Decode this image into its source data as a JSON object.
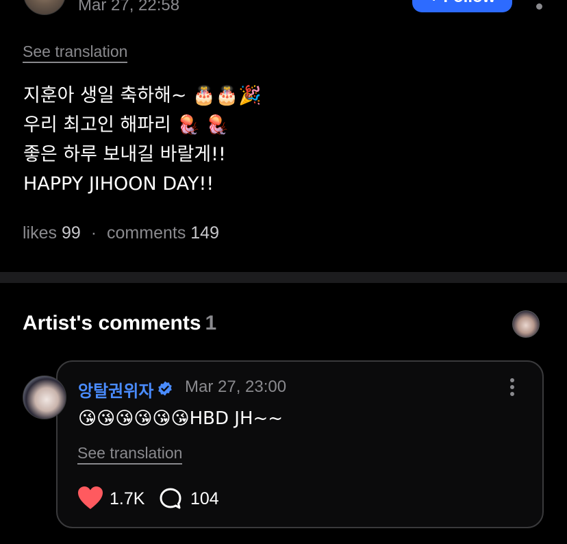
{
  "post": {
    "date": "Mar 27, 22:58",
    "follow_label": "+ Follow",
    "see_translation": "See translation",
    "lines": [
      "지훈아 생일 축하해~ 🎂🎂🎉",
      "우리 최고인 해파리 🪼 🪼",
      "좋은 하루 보내길 바랄게!!",
      "HAPPY JIHOON DAY!!"
    ],
    "likes_label": "likes",
    "likes_count": "99",
    "separator": "·",
    "comments_label": "comments",
    "comments_count": "149"
  },
  "artist_comments": {
    "title": "Artist's comments",
    "count": "1"
  },
  "comment": {
    "author": "앙탈권위자",
    "date": "Mar 27, 23:00",
    "text": "😘😘😘😘😘😘HBD JH~~",
    "see_translation": "See translation",
    "like_count": "1.7K",
    "reply_count": "104"
  },
  "colors": {
    "background": "#000000",
    "accent": "#2d6bff",
    "author_blue": "#4a8cff",
    "heart": "#ff5a5f",
    "muted": "#8a8a8e"
  },
  "icons": [
    "more-dots-icon",
    "verified-badge-icon",
    "heart-icon",
    "reply-bubble-icon"
  ]
}
